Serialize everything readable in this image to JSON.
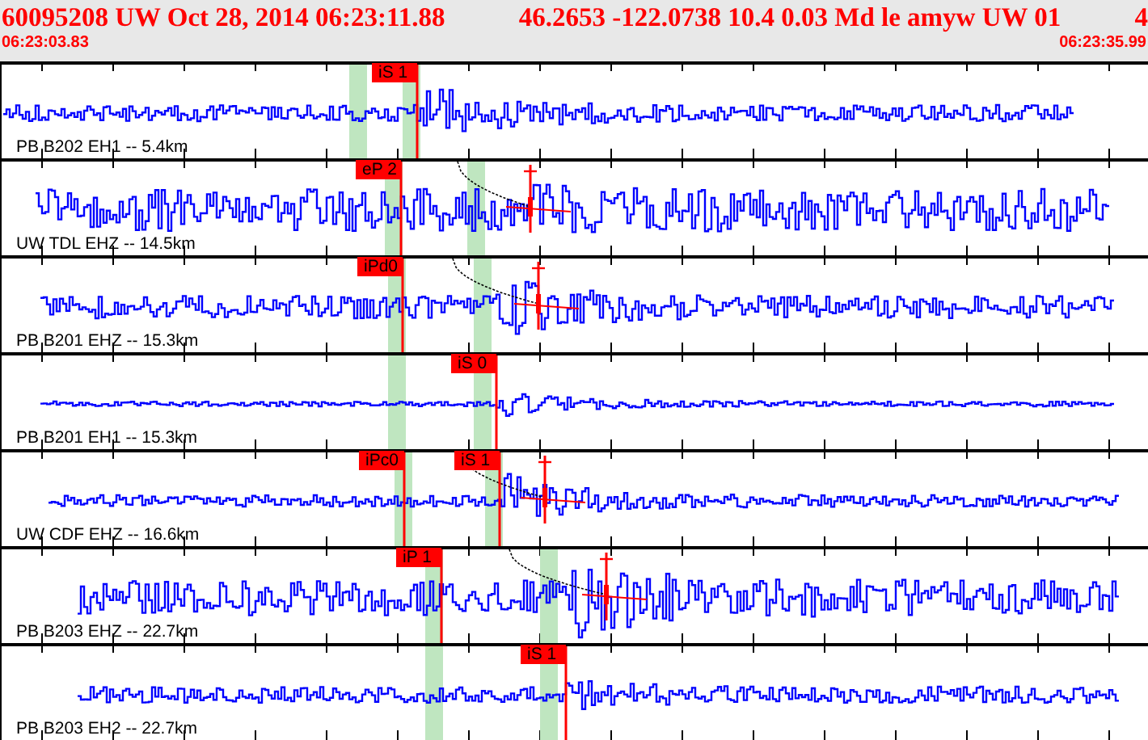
{
  "header": {
    "event": "60095208 UW Oct 28, 2014 06:23:11.88",
    "solution": "46.2653 -122.0738 10.4 0.03 Md le amyw UW 01",
    "trailing": "4",
    "start_time": "06:23:03.83",
    "end_time": "06:23:35.99"
  },
  "traces": [
    {
      "station": "PB B202 EH1 -- 5.4km",
      "picks": [
        {
          "label": "iS 1"
        }
      ]
    },
    {
      "station": "UW TDL EHZ -- 14.5km",
      "picks": [
        {
          "label": "eP 2"
        }
      ]
    },
    {
      "station": "PB B201 EHZ -- 15.3km",
      "picks": [
        {
          "label": "iPd0"
        }
      ]
    },
    {
      "station": "PB B201 EH1 -- 15.3km",
      "picks": [
        {
          "label": "iS 0"
        }
      ]
    },
    {
      "station": "UW CDF EHZ -- 16.6km",
      "picks": [
        {
          "label": "iPc0"
        },
        {
          "label": "iS 1"
        }
      ]
    },
    {
      "station": "PB B203 EHZ -- 22.7km",
      "picks": [
        {
          "label": "iP 1"
        }
      ]
    },
    {
      "station": "PB B203 EH2 -- 22.7km",
      "picks": [
        {
          "label": "iS 1"
        }
      ]
    }
  ]
}
